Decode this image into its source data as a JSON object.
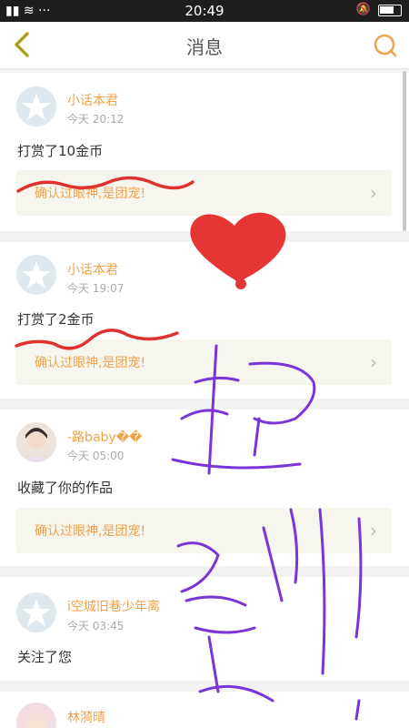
{
  "status_bar": {
    "signal": "▮▮ ≋ ···",
    "time": "20:49"
  },
  "header": {
    "title": "消息"
  },
  "messages": [
    {
      "user": "小话本君",
      "time": "今天 20:12",
      "action": "打赏了10金币",
      "reward_text": "确认过眼神,是团宠!"
    },
    {
      "user": "小话本君",
      "time": "今天 19:07",
      "action": "打赏了2金币",
      "reward_text": "确认过眼神,是团宠!"
    },
    {
      "user": "-路baby��",
      "time": "今天 05:00",
      "action": "收藏了你的作品",
      "reward_text": "确认过眼神,是团宠!"
    },
    {
      "user": "i空城旧巷少年离",
      "time": "今天 03:45",
      "action": "关注了您"
    },
    {
      "user": "林漪晴"
    }
  ],
  "colors": {
    "accent": "#f0a24a",
    "scribble_red": "#e03030",
    "scribble_purple": "#7a35d8"
  }
}
